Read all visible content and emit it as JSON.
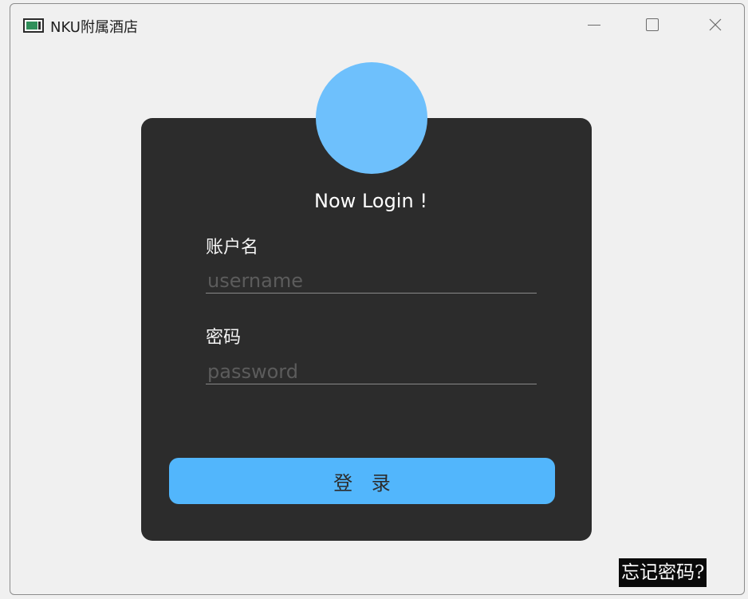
{
  "window": {
    "title": "NKU附属酒店"
  },
  "login": {
    "heading": "Now Login !",
    "username_label": "账户名",
    "username_placeholder": "username",
    "username_value": "",
    "password_label": "密码",
    "password_placeholder": "password",
    "password_value": "",
    "login_button_label": "登 录",
    "forgot_password_label": "忘记密码?"
  },
  "icons": {
    "app": "app-window-icon",
    "minimize": "minimize-icon",
    "maximize": "maximize-icon",
    "close": "close-icon",
    "avatar": "avatar-circle"
  },
  "colors": {
    "background": "#f0f0f0",
    "card": "#2c2c2c",
    "avatar": "#6ec0fc",
    "button": "#52b6fc",
    "forgot_bg": "#0a0a0a"
  }
}
